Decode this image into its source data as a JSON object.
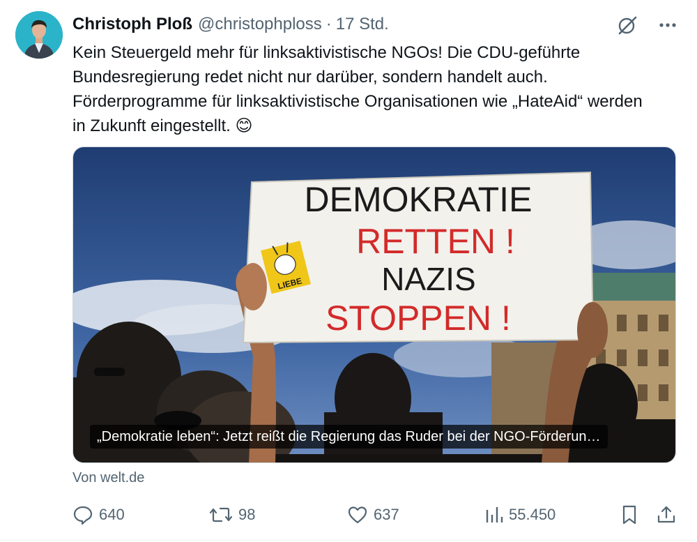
{
  "author": {
    "name": "Christoph Ploß",
    "handle": "@christophploss",
    "separator": "·",
    "time": "17 Std."
  },
  "tweet": {
    "text": "Kein Steuergeld mehr für linksaktivistische NGOs! Die CDU-geführte Bundesregierung redet nicht nur darüber, sondern handelt auch. Förderprogramme für linksaktivistische Organisationen wie „HateAid“ werden in Zukunft eingestellt. 😊"
  },
  "media": {
    "sign_line1": "DEMOKRATIE",
    "sign_line2": "RETTEN !",
    "sign_line3": "NAZIS",
    "sign_line4": "STOPPEN !",
    "sticker_text": "LIEBE",
    "caption": "„Demokratie leben“: Jetzt reißt die Regierung das Ruder bei der NGO-Förderun…"
  },
  "source": "Von welt.de",
  "actions": {
    "replies": "640",
    "reposts": "98",
    "likes": "637",
    "views": "55.450"
  },
  "icons": [
    "grok-icon",
    "more-icon",
    "reply-icon",
    "repost-icon",
    "like-icon",
    "views-icon",
    "bookmark-icon",
    "share-icon"
  ],
  "colors": {
    "text": "#0f1419",
    "secondary": "#536471",
    "sign_red": "#d32a2a",
    "sky": "#2c4f8a"
  }
}
